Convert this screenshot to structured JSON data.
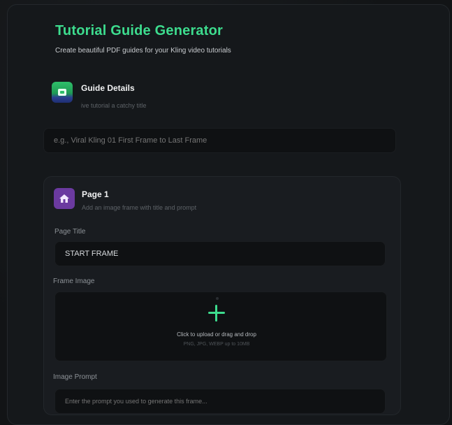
{
  "header": {
    "title": "Tutorial Guide Generator",
    "subtitle": "Create beautiful PDF guides for your Kling video tutorials"
  },
  "guide_details": {
    "title": "Guide Details",
    "subtitle": "ive tutorial a catchy title",
    "title_input": {
      "value": "",
      "placeholder": "e.g., Viral Kling 01 First Frame to Last Frame"
    }
  },
  "page": {
    "title": "Page 1",
    "subtitle": "Add an image frame with title and prompt",
    "page_title_label": "Page Title",
    "page_title_value": "START FRAME",
    "frame_image_label": "Frame Image",
    "upload_text": "Click to upload or drag and drop",
    "upload_hint": "PNG, JPG, WEBP up to 10MB",
    "image_prompt_label": "Image Prompt",
    "image_prompt_placeholder": "Enter the prompt you used to generate this frame..."
  },
  "colors": {
    "accent": "#3ddc8e",
    "page_icon": "#6b3aa0",
    "background": "#121416"
  },
  "icons": {
    "details": "book-icon",
    "page": "home-icon",
    "upload": "plus-icon"
  }
}
